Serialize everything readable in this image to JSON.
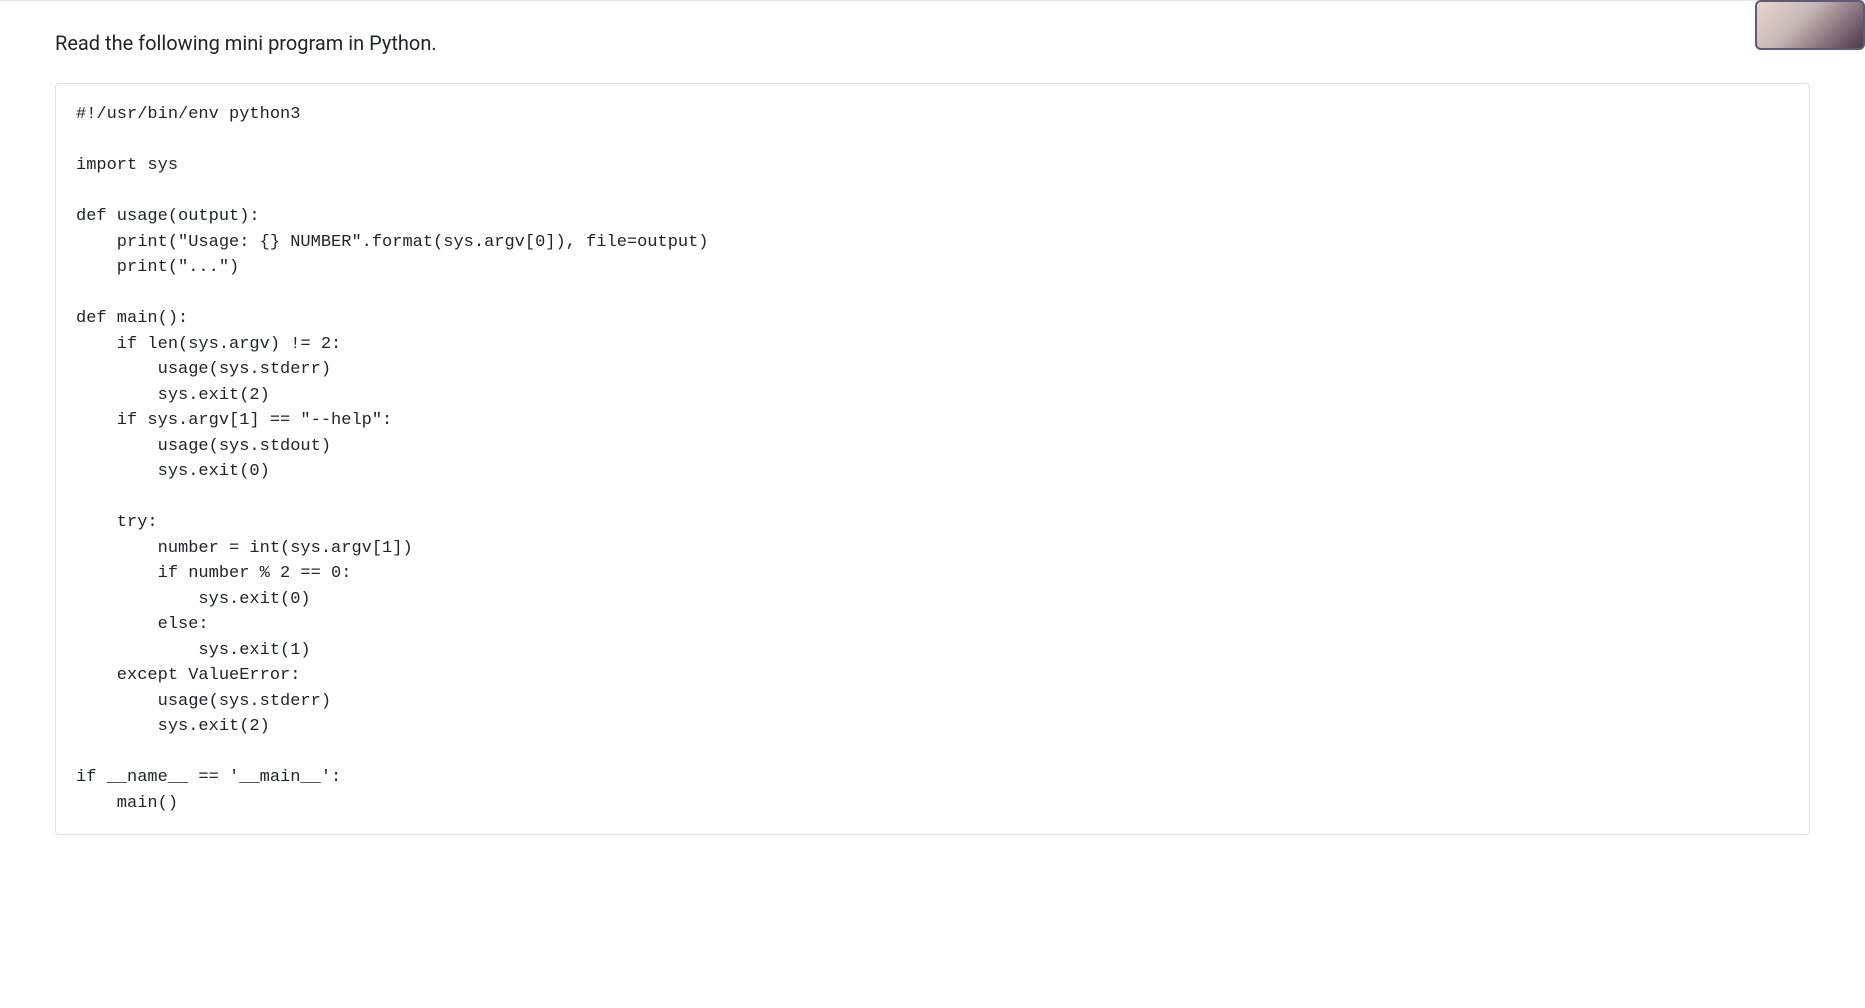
{
  "intro": "Read the following mini program in Python.",
  "code": "#!/usr/bin/env python3\n\nimport sys\n\ndef usage(output):\n    print(\"Usage: {} NUMBER\".format(sys.argv[0]), file=output)\n    print(\"...\")\n\ndef main():\n    if len(sys.argv) != 2:\n        usage(sys.stderr)\n        sys.exit(2)\n    if sys.argv[1] == \"--help\":\n        usage(sys.stdout)\n        sys.exit(0)\n\n    try:\n        number = int(sys.argv[1])\n        if number % 2 == 0:\n            sys.exit(0)\n        else:\n            sys.exit(1)\n    except ValueError:\n        usage(sys.stderr)\n        sys.exit(2)\n\nif __name__ == '__main__':\n    main()"
}
